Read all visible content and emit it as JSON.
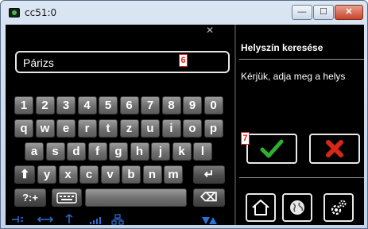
{
  "window": {
    "title": "cc51:0",
    "minimize_symbol": "—",
    "maximize_symbol": "☐",
    "close_symbol": "✕"
  },
  "search": {
    "value": "Párizs"
  },
  "markers": {
    "m6": "6",
    "m7": "7"
  },
  "panel": {
    "title": "Helyszín keresése",
    "instruction": "Kérjük, adja meg a helys"
  },
  "keyboard": {
    "row1": [
      "1",
      "2",
      "3",
      "4",
      "5",
      "6",
      "7",
      "8",
      "9",
      "0"
    ],
    "row2": [
      "q",
      "w",
      "e",
      "r",
      "t",
      "z",
      "u",
      "i",
      "o",
      "p"
    ],
    "row3": [
      "a",
      "s",
      "d",
      "f",
      "g",
      "h",
      "j",
      "k",
      "l"
    ],
    "row4": [
      "y",
      "x",
      "c",
      "v",
      "b",
      "n",
      "m"
    ],
    "shift_symbol": "⬆",
    "enter_symbol": "↵",
    "symbols_label": "?:+",
    "backspace_symbol": "⌫"
  },
  "icons": {
    "confirm": "check-icon",
    "cancel": "cross-icon",
    "home": "home-icon",
    "globe": "globe-icon",
    "settings": "settings-icon"
  },
  "colors": {
    "confirm_green": "#2fae2f",
    "cancel_red": "#d8261a",
    "status_blue": "#2a70d8"
  }
}
